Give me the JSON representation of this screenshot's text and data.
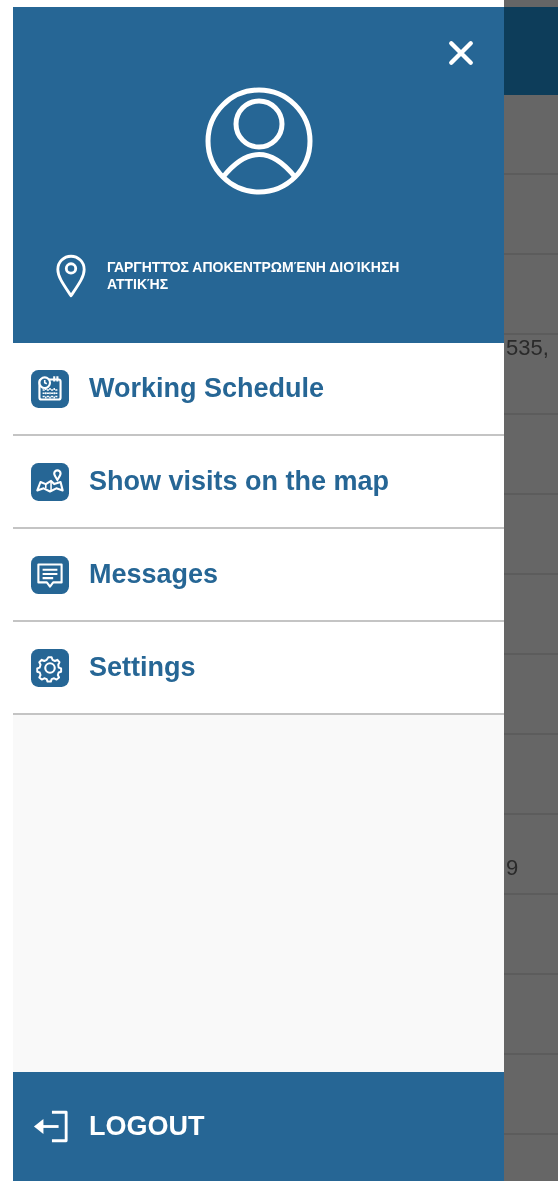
{
  "background": {
    "texts": [
      "535,",
      "9"
    ]
  },
  "drawer": {
    "header": {
      "location": "ΓΑΡΓΗΤΤΌΣ ΑΠΟΚΕΝΤΡΩΜΈΝΗ ΔΙΟΊΚΗΣΗ ΑΤΤΙΚΉΣ"
    },
    "items": [
      {
        "label": "Working Schedule",
        "kind": "schedule"
      },
      {
        "label": "Show visits on the map",
        "kind": "map"
      },
      {
        "label": "Messages",
        "kind": "messages"
      },
      {
        "label": "Settings",
        "kind": "settings"
      }
    ],
    "footer": {
      "label": "LOGOUT"
    }
  }
}
